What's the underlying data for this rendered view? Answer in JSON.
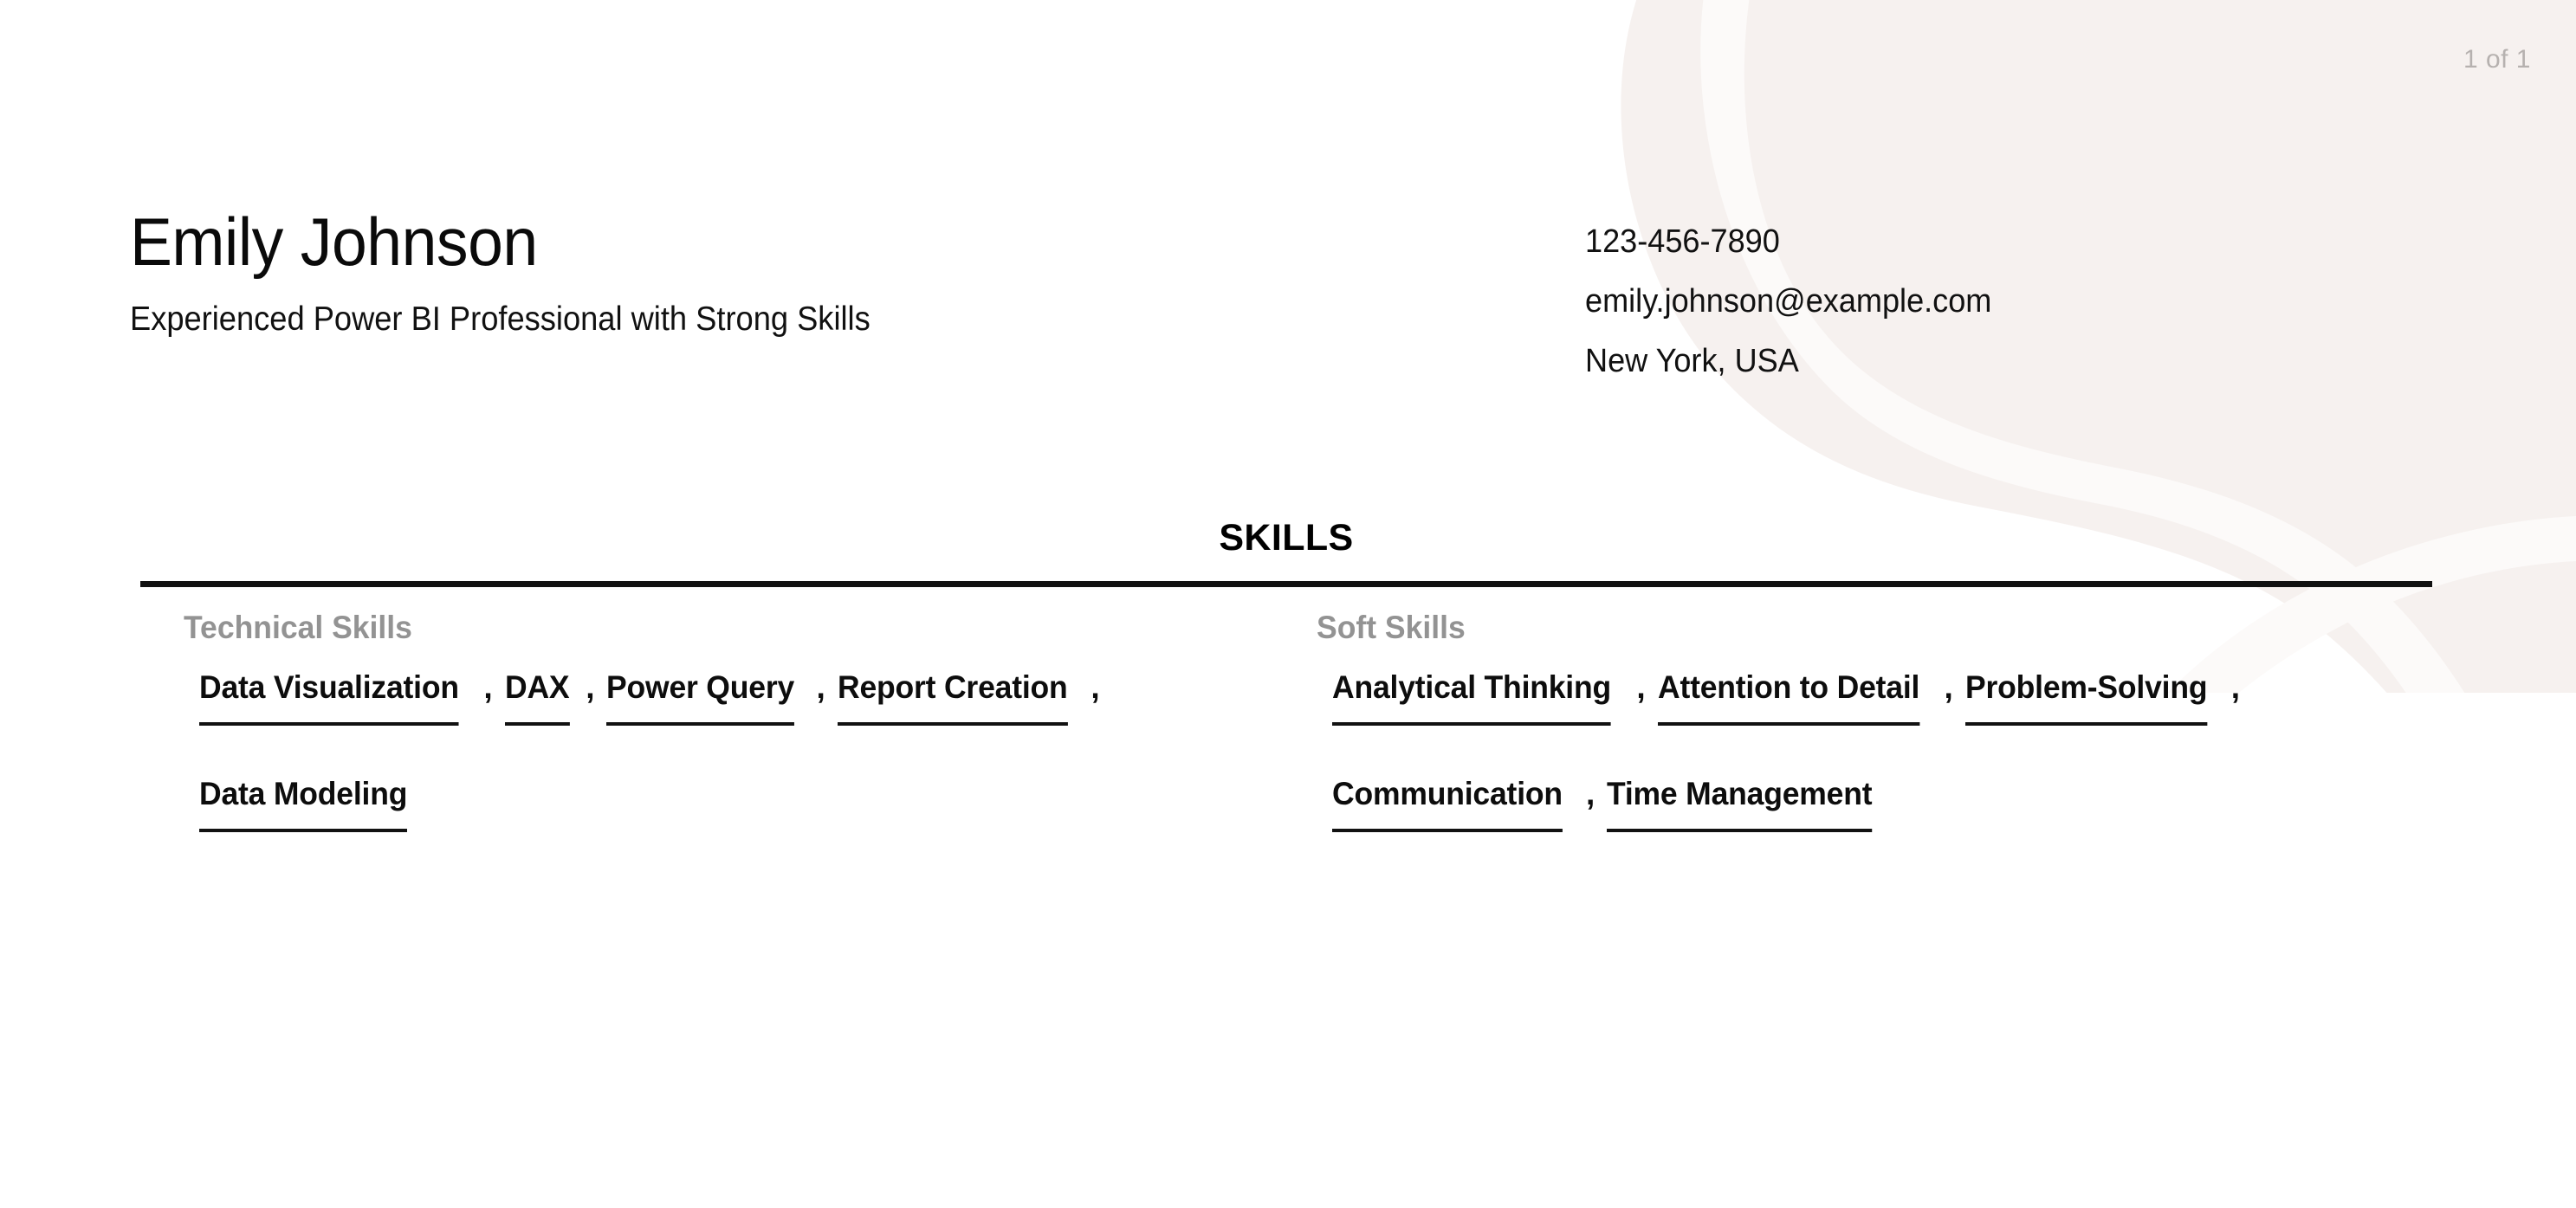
{
  "page_indicator": "1 of 1",
  "colors": {
    "decor_blob": "#f6f1ef",
    "decor_swirl": "#fcfaf9",
    "page_background": "#ffffff",
    "text_primary": "#0d0d0d",
    "text_muted": "#939393",
    "page_indicator": "#b6b1af",
    "rule": "#121212"
  },
  "header": {
    "full_name": "Emily Johnson",
    "headline": "Experienced Power BI Professional with Strong Skills",
    "contact": [
      "123-456-7890",
      "emily.johnson@example.com",
      "New York, USA"
    ]
  },
  "skills_section": {
    "title": "SKILLS",
    "columns": [
      {
        "title": "Technical Skills",
        "items": [
          "Data Visualization",
          "DAX",
          "Power Query",
          "Report Creation",
          "Data Modeling"
        ]
      },
      {
        "title": "Soft Skills",
        "items": [
          "Analytical Thinking",
          "Attention to Detail",
          "Problem-Solving",
          "Communication",
          "Time Management"
        ]
      }
    ],
    "separator": ","
  }
}
